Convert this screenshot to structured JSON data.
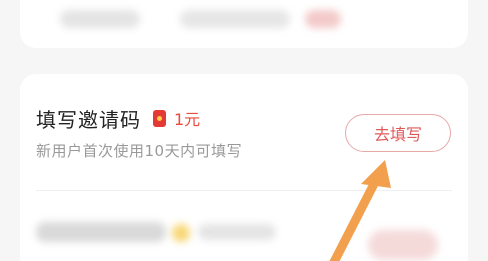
{
  "task": {
    "title": "填写邀请码",
    "reward": "1元",
    "description": "新用户首次使用10天内可填写",
    "button_label": "去填写"
  },
  "icons": {
    "reward_icon": "red-packet-icon",
    "arrow": "pointer-arrow-icon"
  },
  "colors": {
    "accent_red": "#e84c3d",
    "button_border": "#e9a8a8",
    "arrow_orange": "#f2a04e",
    "background": "#f6f6f6"
  }
}
